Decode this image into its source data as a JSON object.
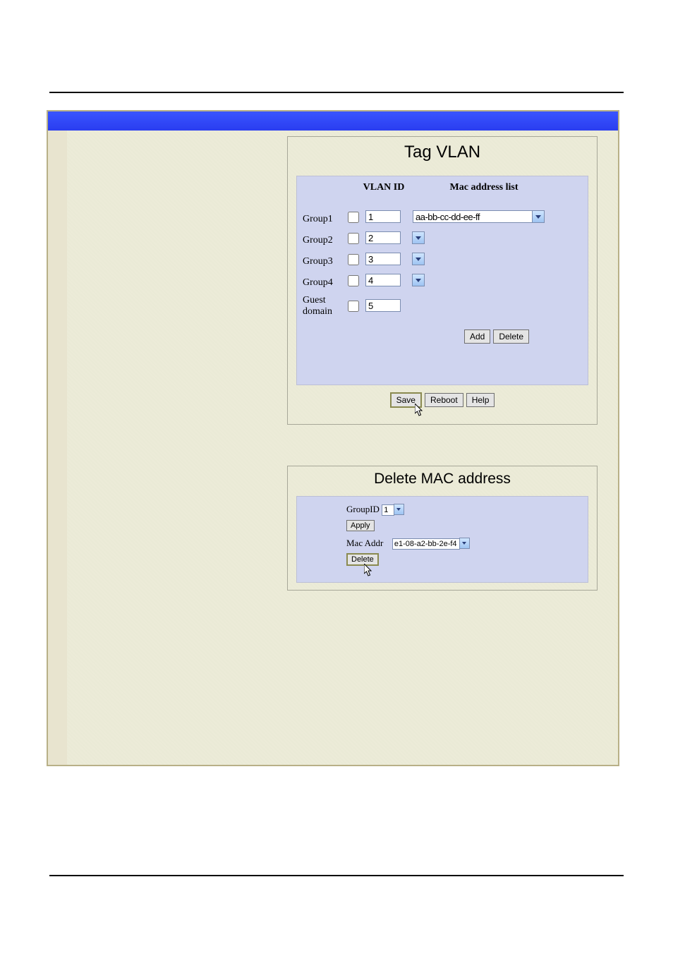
{
  "panel1": {
    "title": "Tag VLAN",
    "headers": {
      "vlan": "VLAN ID",
      "mac": "Mac address list"
    },
    "rows": [
      {
        "label": "Group1",
        "vlan": "1",
        "mac": "aa-bb-cc-dd-ee-ff"
      },
      {
        "label": "Group2",
        "vlan": "2",
        "mac": ""
      },
      {
        "label": "Group3",
        "vlan": "3",
        "mac": ""
      },
      {
        "label": "Group4",
        "vlan": "4",
        "mac": ""
      },
      {
        "label": "Guest domain",
        "vlan": "5",
        "mac": null
      }
    ],
    "add_btn": "Add",
    "delete_btn": "Delete",
    "save_btn": "Save",
    "reboot_btn": "Reboot",
    "help_btn": "Help"
  },
  "panel2": {
    "title": "Delete MAC address",
    "groupid_label": "GroupID",
    "groupid_value": "1",
    "apply_btn": "Apply",
    "macaddr_label": "Mac Addr",
    "macaddr_value": "e1-08-a2-bb-2e-f4",
    "delete_btn": "Delete"
  }
}
